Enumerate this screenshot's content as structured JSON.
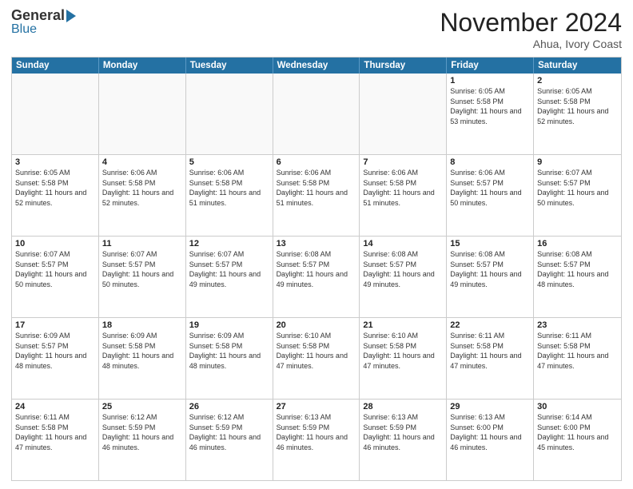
{
  "header": {
    "logo_general": "General",
    "logo_blue": "Blue",
    "month_title": "November 2024",
    "location": "Ahua, Ivory Coast"
  },
  "calendar": {
    "days_of_week": [
      "Sunday",
      "Monday",
      "Tuesday",
      "Wednesday",
      "Thursday",
      "Friday",
      "Saturday"
    ],
    "weeks": [
      [
        {
          "day": "",
          "info": "",
          "empty": true
        },
        {
          "day": "",
          "info": "",
          "empty": true
        },
        {
          "day": "",
          "info": "",
          "empty": true
        },
        {
          "day": "",
          "info": "",
          "empty": true
        },
        {
          "day": "",
          "info": "",
          "empty": true
        },
        {
          "day": "1",
          "info": "Sunrise: 6:05 AM\nSunset: 5:58 PM\nDaylight: 11 hours and 53 minutes.",
          "empty": false
        },
        {
          "day": "2",
          "info": "Sunrise: 6:05 AM\nSunset: 5:58 PM\nDaylight: 11 hours and 52 minutes.",
          "empty": false
        }
      ],
      [
        {
          "day": "3",
          "info": "Sunrise: 6:05 AM\nSunset: 5:58 PM\nDaylight: 11 hours and 52 minutes.",
          "empty": false
        },
        {
          "day": "4",
          "info": "Sunrise: 6:06 AM\nSunset: 5:58 PM\nDaylight: 11 hours and 52 minutes.",
          "empty": false
        },
        {
          "day": "5",
          "info": "Sunrise: 6:06 AM\nSunset: 5:58 PM\nDaylight: 11 hours and 51 minutes.",
          "empty": false
        },
        {
          "day": "6",
          "info": "Sunrise: 6:06 AM\nSunset: 5:58 PM\nDaylight: 11 hours and 51 minutes.",
          "empty": false
        },
        {
          "day": "7",
          "info": "Sunrise: 6:06 AM\nSunset: 5:58 PM\nDaylight: 11 hours and 51 minutes.",
          "empty": false
        },
        {
          "day": "8",
          "info": "Sunrise: 6:06 AM\nSunset: 5:57 PM\nDaylight: 11 hours and 50 minutes.",
          "empty": false
        },
        {
          "day": "9",
          "info": "Sunrise: 6:07 AM\nSunset: 5:57 PM\nDaylight: 11 hours and 50 minutes.",
          "empty": false
        }
      ],
      [
        {
          "day": "10",
          "info": "Sunrise: 6:07 AM\nSunset: 5:57 PM\nDaylight: 11 hours and 50 minutes.",
          "empty": false
        },
        {
          "day": "11",
          "info": "Sunrise: 6:07 AM\nSunset: 5:57 PM\nDaylight: 11 hours and 50 minutes.",
          "empty": false
        },
        {
          "day": "12",
          "info": "Sunrise: 6:07 AM\nSunset: 5:57 PM\nDaylight: 11 hours and 49 minutes.",
          "empty": false
        },
        {
          "day": "13",
          "info": "Sunrise: 6:08 AM\nSunset: 5:57 PM\nDaylight: 11 hours and 49 minutes.",
          "empty": false
        },
        {
          "day": "14",
          "info": "Sunrise: 6:08 AM\nSunset: 5:57 PM\nDaylight: 11 hours and 49 minutes.",
          "empty": false
        },
        {
          "day": "15",
          "info": "Sunrise: 6:08 AM\nSunset: 5:57 PM\nDaylight: 11 hours and 49 minutes.",
          "empty": false
        },
        {
          "day": "16",
          "info": "Sunrise: 6:08 AM\nSunset: 5:57 PM\nDaylight: 11 hours and 48 minutes.",
          "empty": false
        }
      ],
      [
        {
          "day": "17",
          "info": "Sunrise: 6:09 AM\nSunset: 5:57 PM\nDaylight: 11 hours and 48 minutes.",
          "empty": false
        },
        {
          "day": "18",
          "info": "Sunrise: 6:09 AM\nSunset: 5:58 PM\nDaylight: 11 hours and 48 minutes.",
          "empty": false
        },
        {
          "day": "19",
          "info": "Sunrise: 6:09 AM\nSunset: 5:58 PM\nDaylight: 11 hours and 48 minutes.",
          "empty": false
        },
        {
          "day": "20",
          "info": "Sunrise: 6:10 AM\nSunset: 5:58 PM\nDaylight: 11 hours and 47 minutes.",
          "empty": false
        },
        {
          "day": "21",
          "info": "Sunrise: 6:10 AM\nSunset: 5:58 PM\nDaylight: 11 hours and 47 minutes.",
          "empty": false
        },
        {
          "day": "22",
          "info": "Sunrise: 6:11 AM\nSunset: 5:58 PM\nDaylight: 11 hours and 47 minutes.",
          "empty": false
        },
        {
          "day": "23",
          "info": "Sunrise: 6:11 AM\nSunset: 5:58 PM\nDaylight: 11 hours and 47 minutes.",
          "empty": false
        }
      ],
      [
        {
          "day": "24",
          "info": "Sunrise: 6:11 AM\nSunset: 5:58 PM\nDaylight: 11 hours and 47 minutes.",
          "empty": false
        },
        {
          "day": "25",
          "info": "Sunrise: 6:12 AM\nSunset: 5:59 PM\nDaylight: 11 hours and 46 minutes.",
          "empty": false
        },
        {
          "day": "26",
          "info": "Sunrise: 6:12 AM\nSunset: 5:59 PM\nDaylight: 11 hours and 46 minutes.",
          "empty": false
        },
        {
          "day": "27",
          "info": "Sunrise: 6:13 AM\nSunset: 5:59 PM\nDaylight: 11 hours and 46 minutes.",
          "empty": false
        },
        {
          "day": "28",
          "info": "Sunrise: 6:13 AM\nSunset: 5:59 PM\nDaylight: 11 hours and 46 minutes.",
          "empty": false
        },
        {
          "day": "29",
          "info": "Sunrise: 6:13 AM\nSunset: 6:00 PM\nDaylight: 11 hours and 46 minutes.",
          "empty": false
        },
        {
          "day": "30",
          "info": "Sunrise: 6:14 AM\nSunset: 6:00 PM\nDaylight: 11 hours and 45 minutes.",
          "empty": false
        }
      ]
    ]
  }
}
